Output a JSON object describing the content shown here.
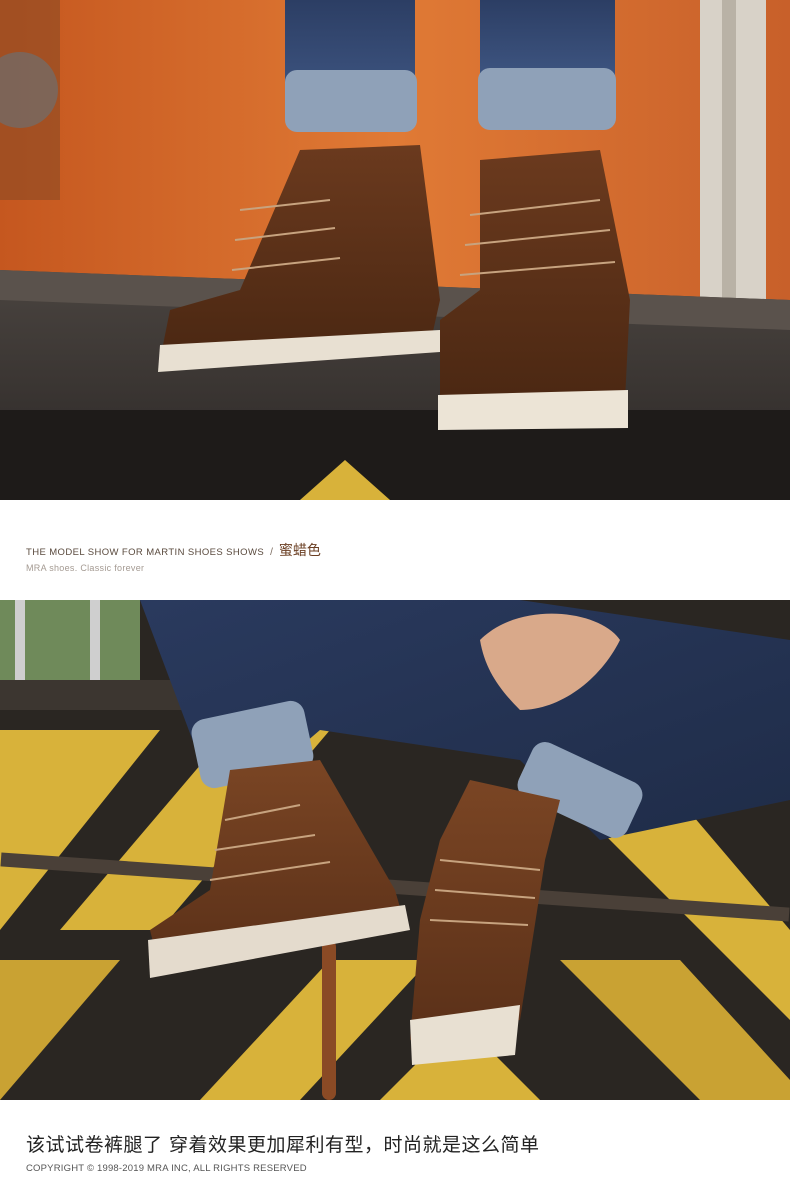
{
  "caption": {
    "title_en": "THE MODEL SHOW FOR MARTIN SHOES SHOWS",
    "separator": "/",
    "color_name": "蜜蜡色",
    "subtitle": "MRA shoes. Classic forever"
  },
  "footer": {
    "headline": "该试试卷裤腿了 穿着效果更加犀利有型，时尚就是这么简单",
    "copyright": "COPYRIGHT © 1998-2019 MRA INC,  ALL RIGHTS RESERVED"
  },
  "colors": {
    "accent_brown": "#6b3f23",
    "wall_orange": "#d86a2c",
    "hazard_yellow": "#d8b23a"
  }
}
